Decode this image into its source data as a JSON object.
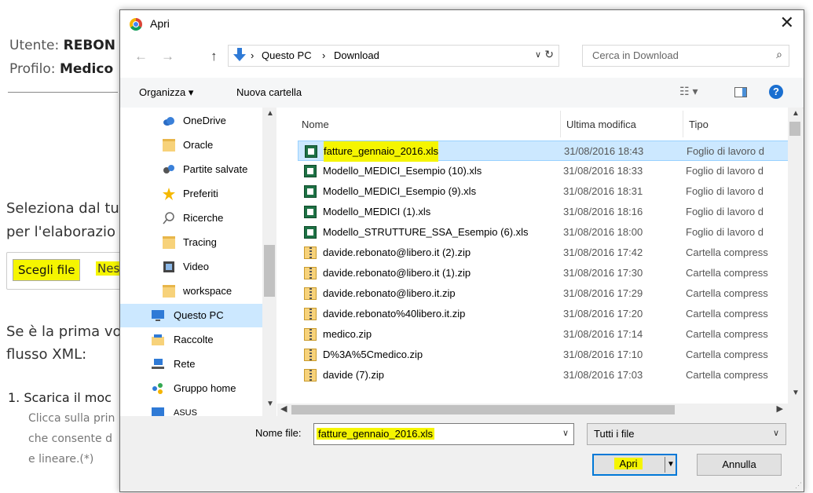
{
  "background_page": {
    "user_label": "Utente:",
    "user_value": "REBON",
    "profile_label": "Profilo:",
    "profile_value": "Medico",
    "section_line1": "Seleziona dal tu",
    "section_line2": "per l'elaborazio",
    "choose_file_button": "Scegli file",
    "no_file_text": "Nes",
    "first_time_line1": "Se è la prima vo",
    "first_time_line2": "flusso XML:",
    "step1_title": "1. Scarica il moc",
    "step1_text1": "Clicca sulla prin",
    "step1_text2": "che consente d",
    "step1_text3": "e lineare.(*)"
  },
  "dialog": {
    "title": "Apri",
    "close": "✕",
    "nav_back": "←",
    "nav_forward": "→",
    "nav_up": "↑",
    "breadcrumb": [
      "Questo PC",
      "Download"
    ],
    "breadcrumb_sep": "›",
    "address_dropdown": "∨",
    "refresh": "↻",
    "search_placeholder": "Cerca in Download",
    "search_icon": "⌕",
    "toolbar": {
      "organize": "Organizza ▾",
      "new_folder": "Nuova cartella",
      "view_icon": "☷ ▾",
      "help": "?"
    },
    "nav_items": [
      {
        "label": "OneDrive",
        "icon": "cloud-icon"
      },
      {
        "label": "Oracle",
        "icon": "folder-icon"
      },
      {
        "label": "Partite salvate",
        "icon": "saved-games-icon"
      },
      {
        "label": "Preferiti",
        "icon": "star-icon"
      },
      {
        "label": "Ricerche",
        "icon": "search-icon"
      },
      {
        "label": "Tracing",
        "icon": "folder-icon"
      },
      {
        "label": "Video",
        "icon": "video-icon"
      },
      {
        "label": "workspace",
        "icon": "folder-icon"
      },
      {
        "label": "Questo PC",
        "icon": "computer-icon",
        "selected": true
      },
      {
        "label": "Raccolte",
        "icon": "libraries-icon"
      },
      {
        "label": "Rete",
        "icon": "network-icon"
      },
      {
        "label": "Gruppo home",
        "icon": "homegroup-icon"
      },
      {
        "label": "ASUS",
        "icon": "computer-icon"
      }
    ],
    "columns": {
      "name": "Nome",
      "modified": "Ultima modifica",
      "type": "Tipo"
    },
    "files": [
      {
        "name": "fatture_gennaio_2016.xls",
        "modified": "31/08/2016 18:43",
        "type": "Foglio di lavoro d",
        "kind": "xls",
        "selected": true
      },
      {
        "name": "Modello_MEDICI_Esempio (10).xls",
        "modified": "31/08/2016 18:33",
        "type": "Foglio di lavoro d",
        "kind": "xls"
      },
      {
        "name": "Modello_MEDICI_Esempio (9).xls",
        "modified": "31/08/2016 18:31",
        "type": "Foglio di lavoro d",
        "kind": "xls"
      },
      {
        "name": "Modello_MEDICI (1).xls",
        "modified": "31/08/2016 18:16",
        "type": "Foglio di lavoro d",
        "kind": "xls"
      },
      {
        "name": "Modello_STRUTTURE_SSA_Esempio (6).xls",
        "modified": "31/08/2016 18:00",
        "type": "Foglio di lavoro d",
        "kind": "xls"
      },
      {
        "name": "davide.rebonato@libero.it (2).zip",
        "modified": "31/08/2016 17:42",
        "type": "Cartella compress",
        "kind": "zip"
      },
      {
        "name": "davide.rebonato@libero.it (1).zip",
        "modified": "31/08/2016 17:30",
        "type": "Cartella compress",
        "kind": "zip"
      },
      {
        "name": "davide.rebonato@libero.it.zip",
        "modified": "31/08/2016 17:29",
        "type": "Cartella compress",
        "kind": "zip"
      },
      {
        "name": "davide.rebonato%40libero.it.zip",
        "modified": "31/08/2016 17:20",
        "type": "Cartella compress",
        "kind": "zip"
      },
      {
        "name": "medico.zip",
        "modified": "31/08/2016 17:14",
        "type": "Cartella compress",
        "kind": "zip"
      },
      {
        "name": "D%3A%5Cmedico.zip",
        "modified": "31/08/2016 17:10",
        "type": "Cartella compress",
        "kind": "zip"
      },
      {
        "name": "davide (7).zip",
        "modified": "31/08/2016 17:03",
        "type": "Cartella compress",
        "kind": "zip"
      }
    ],
    "filename_label": "Nome file:",
    "filename_value": "fatture_gennaio_2016.xls",
    "filetype_value": "Tutti i file",
    "open_button": "Apri",
    "cancel_button": "Annulla",
    "highlight_color": "#f5f500",
    "selection_color": "#cce8ff"
  }
}
